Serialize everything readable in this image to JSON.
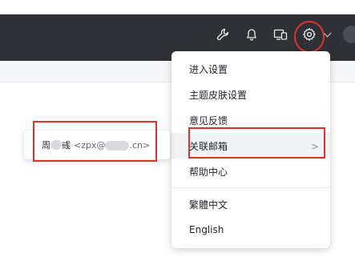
{
  "menu": {
    "items": [
      {
        "label": "进入设置"
      },
      {
        "label": "主题皮肤设置"
      },
      {
        "label": "意见反馈"
      },
      {
        "label": "关联邮箱",
        "has_submenu": true
      },
      {
        "label": "帮助中心"
      },
      {
        "label": "繁體中文"
      },
      {
        "label": "English"
      }
    ],
    "submenu_arrow": ">"
  },
  "submenu": {
    "account_name_prefix": "周",
    "account_name_suffix": "彧",
    "email_prefix": "<zpx@",
    "email_suffix": ".cn>"
  },
  "icons": [
    "wrench-icon",
    "bell-icon",
    "devices-icon",
    "gear-icon",
    "chevron-down-icon",
    "avatar"
  ],
  "colors": {
    "topbar": "#2f3136",
    "annotation_red": "#e0322c"
  }
}
